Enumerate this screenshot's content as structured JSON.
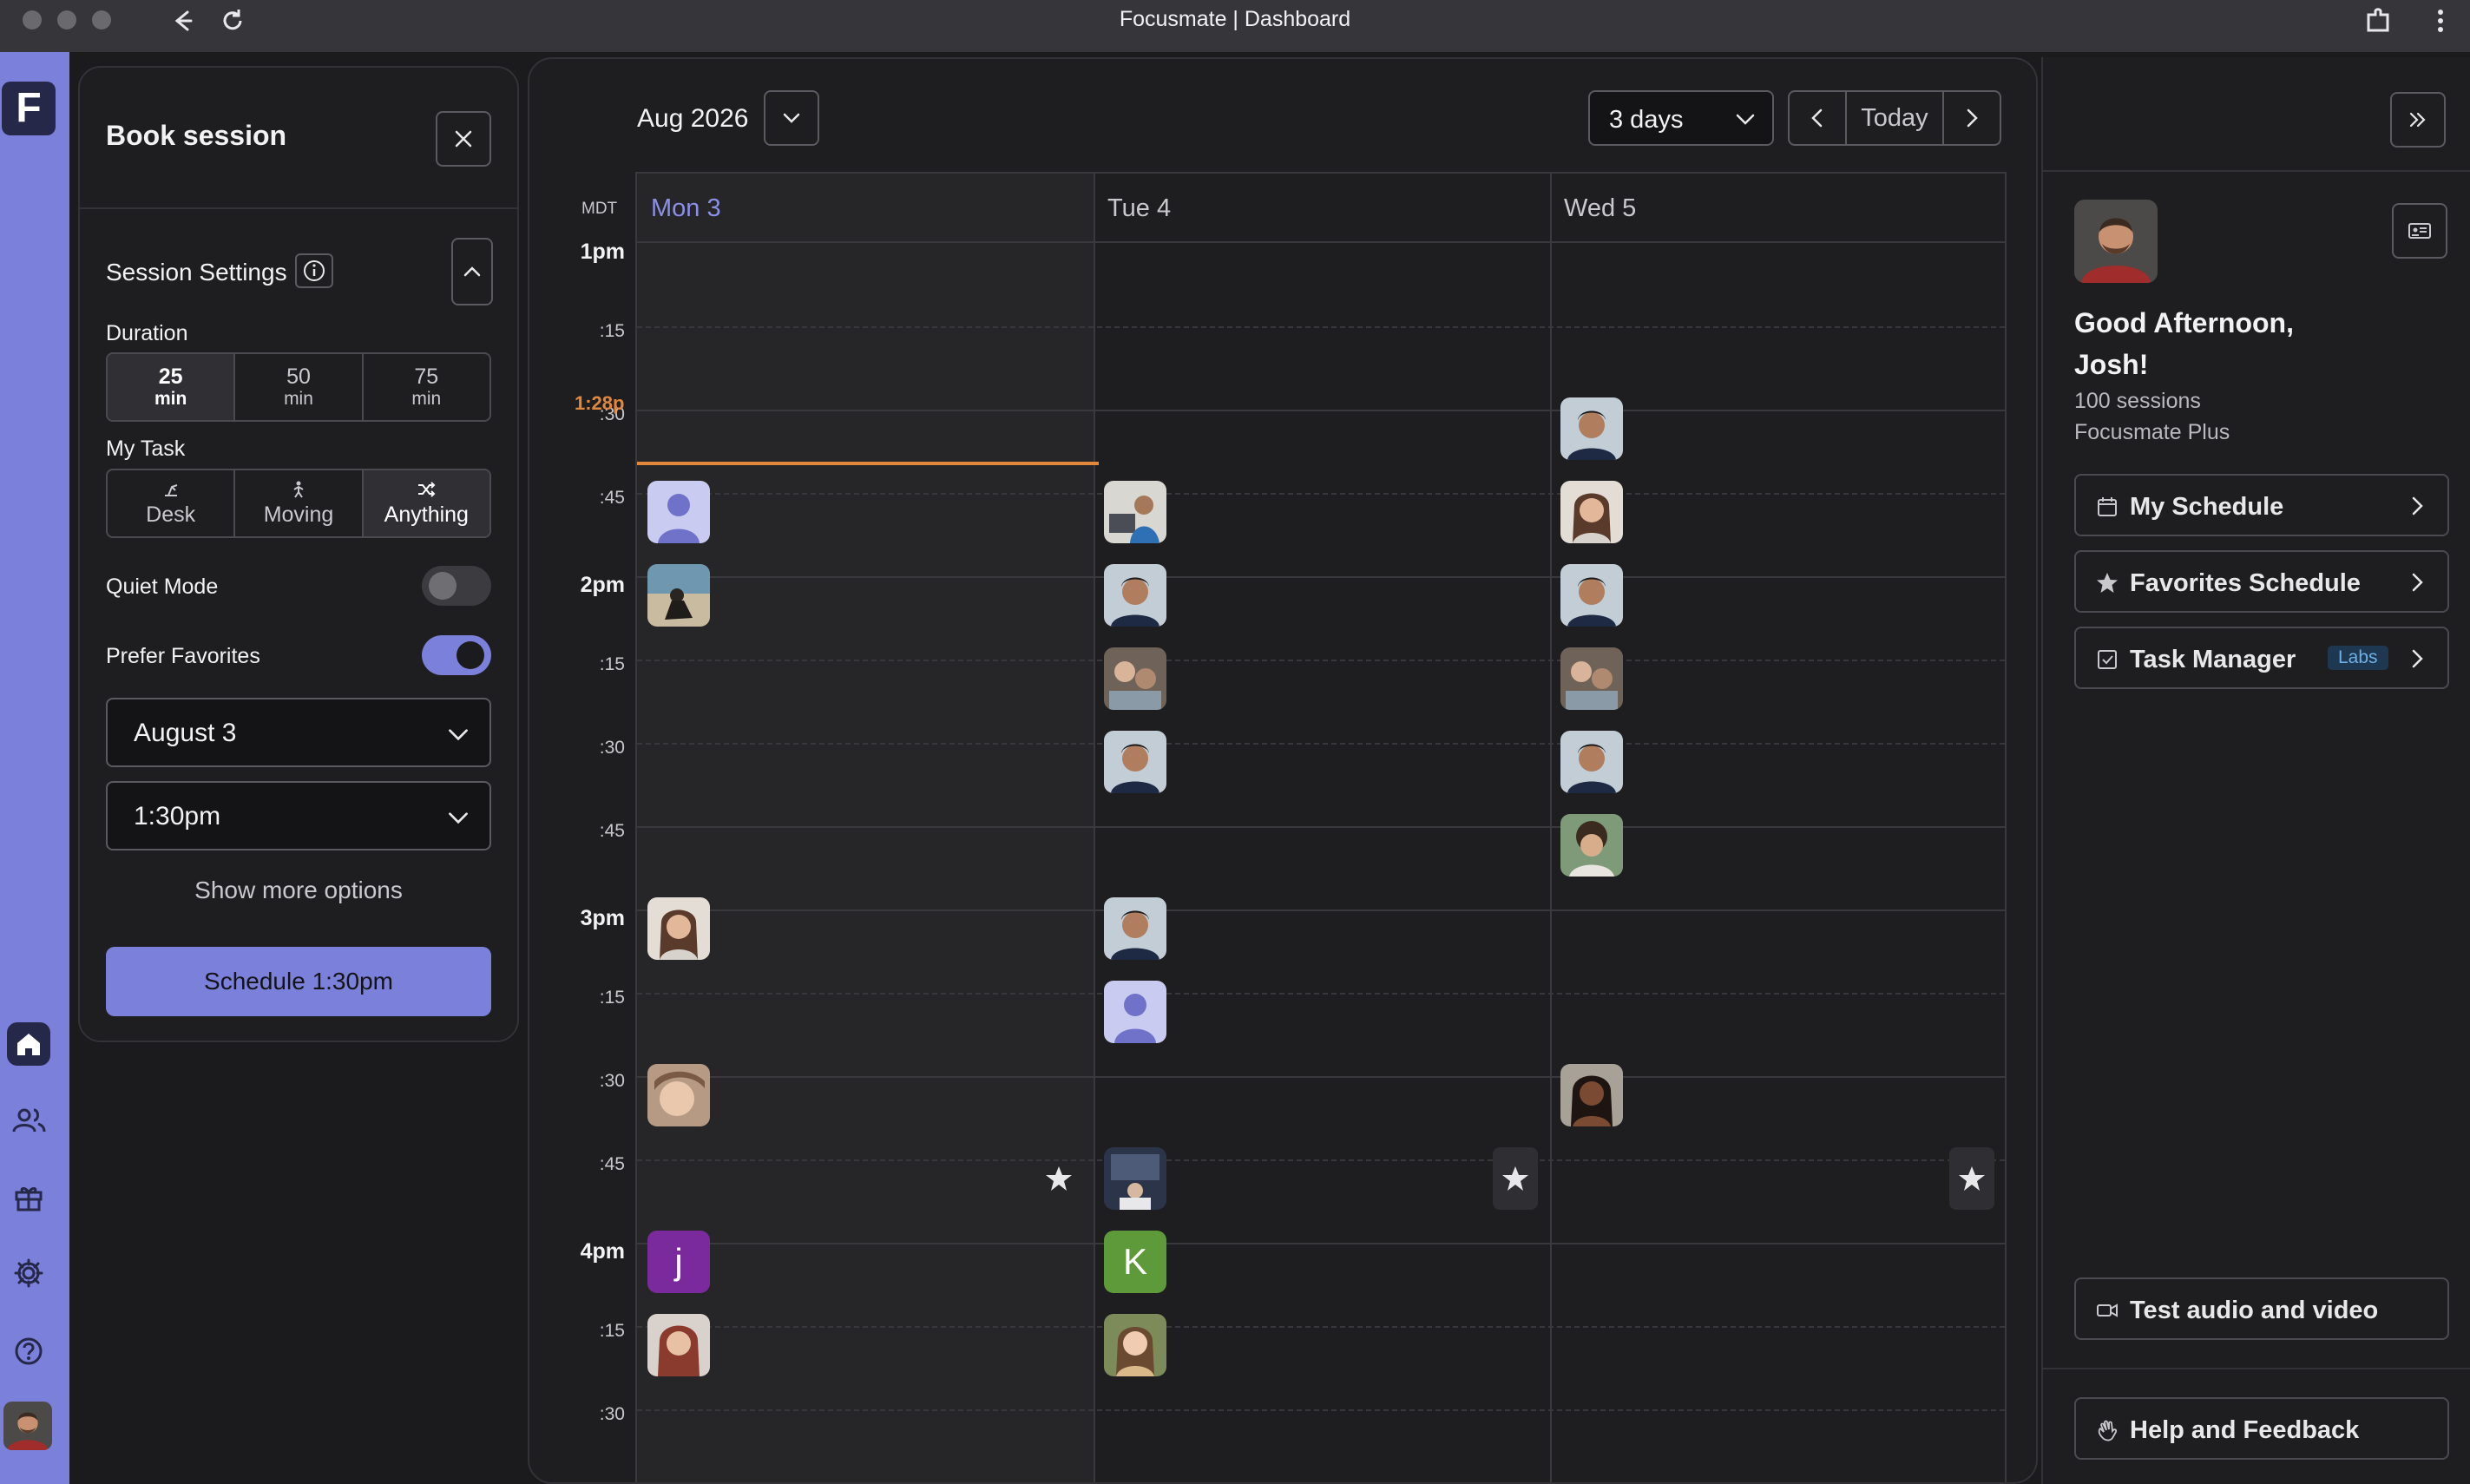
{
  "window": {
    "title": "Focusmate | Dashboard"
  },
  "rail": {
    "logo": "F",
    "icons": [
      "home-icon",
      "people-icon",
      "gift-icon",
      "gear-icon",
      "help-icon"
    ]
  },
  "book": {
    "title": "Book session",
    "settings_label": "Session Settings",
    "duration_label": "Duration",
    "durations": [
      {
        "num": "25",
        "unit": "min",
        "selected": true
      },
      {
        "num": "50",
        "unit": "min",
        "selected": false
      },
      {
        "num": "75",
        "unit": "min",
        "selected": false
      }
    ],
    "task_label": "My Task",
    "tasks": [
      {
        "label": "Desk",
        "icon": "desk-icon",
        "selected": false
      },
      {
        "label": "Moving",
        "icon": "walking-icon",
        "selected": false
      },
      {
        "label": "Anything",
        "icon": "shuffle-icon",
        "selected": true
      }
    ],
    "quiet_mode": {
      "label": "Quiet Mode",
      "on": false
    },
    "prefer_favorites": {
      "label": "Prefer Favorites",
      "on": true
    },
    "date_value": "August 3",
    "time_value": "1:30pm",
    "more_options": "Show more options",
    "schedule_button": "Schedule 1:30pm"
  },
  "calendar": {
    "month": "Aug 2026",
    "view": "3 days",
    "today_button": "Today",
    "timezone": "MDT",
    "now_label": "1:28p",
    "days": [
      "Mon 3",
      "Tue 4",
      "Wed 5"
    ],
    "time_labels": [
      {
        "text": "1pm",
        "hour": true
      },
      {
        "text": ":15",
        "hour": false
      },
      {
        "text": ":30",
        "hour": false
      },
      {
        "text": ":45",
        "hour": false
      },
      {
        "text": "2pm",
        "hour": true
      },
      {
        "text": ":15",
        "hour": false
      },
      {
        "text": ":30",
        "hour": false
      },
      {
        "text": ":45",
        "hour": false
      },
      {
        "text": "3pm",
        "hour": true
      },
      {
        "text": ":15",
        "hour": false
      },
      {
        "text": ":30",
        "hour": false
      },
      {
        "text": ":45",
        "hour": false
      },
      {
        "text": "4pm",
        "hour": true
      },
      {
        "text": ":15",
        "hour": false
      },
      {
        "text": ":30",
        "hour": false
      }
    ],
    "letter_avatars": [
      {
        "letter": "j",
        "color": "#7a2a9c"
      },
      {
        "letter": "K",
        "color": "#5e9a3a"
      }
    ]
  },
  "profile": {
    "greeting": "Good Afternoon, Josh!",
    "sessions": "100 sessions",
    "plan": "Focusmate Plus",
    "links": [
      {
        "label": "My Schedule",
        "icon": "calendar-icon"
      },
      {
        "label": "Favorites Schedule",
        "icon": "star-icon"
      },
      {
        "label": "Task Manager",
        "icon": "checkbox-icon",
        "badge": "Labs"
      }
    ],
    "test_av": "Test audio and video",
    "help": "Help and Feedback"
  },
  "colors": {
    "accent": "#7b80db",
    "now_line": "#e2883d",
    "today_header": "#8b8fe8"
  }
}
